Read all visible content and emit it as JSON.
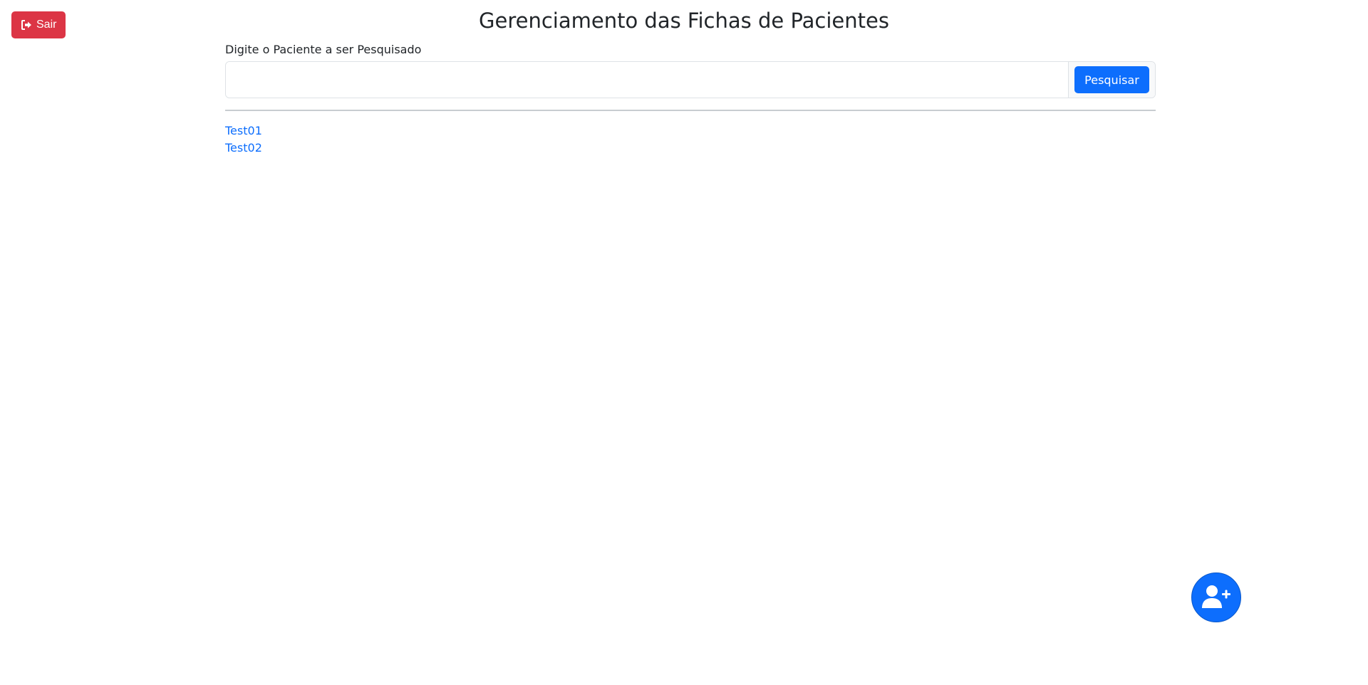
{
  "header": {
    "logout_label": "Sair",
    "logout_icon": "sign-out-icon",
    "title": "Gerenciamento das Fichas de Pacientes"
  },
  "search": {
    "label": "Digite o Paciente a ser Pesquisado",
    "value": "",
    "placeholder": "",
    "button_label": "Pesquisar"
  },
  "patients": [
    {
      "name": "Test01"
    },
    {
      "name": "Test02"
    }
  ],
  "fab": {
    "icon": "user-plus-icon"
  },
  "colors": {
    "danger": "#dc3545",
    "primary": "#0d6efd"
  }
}
